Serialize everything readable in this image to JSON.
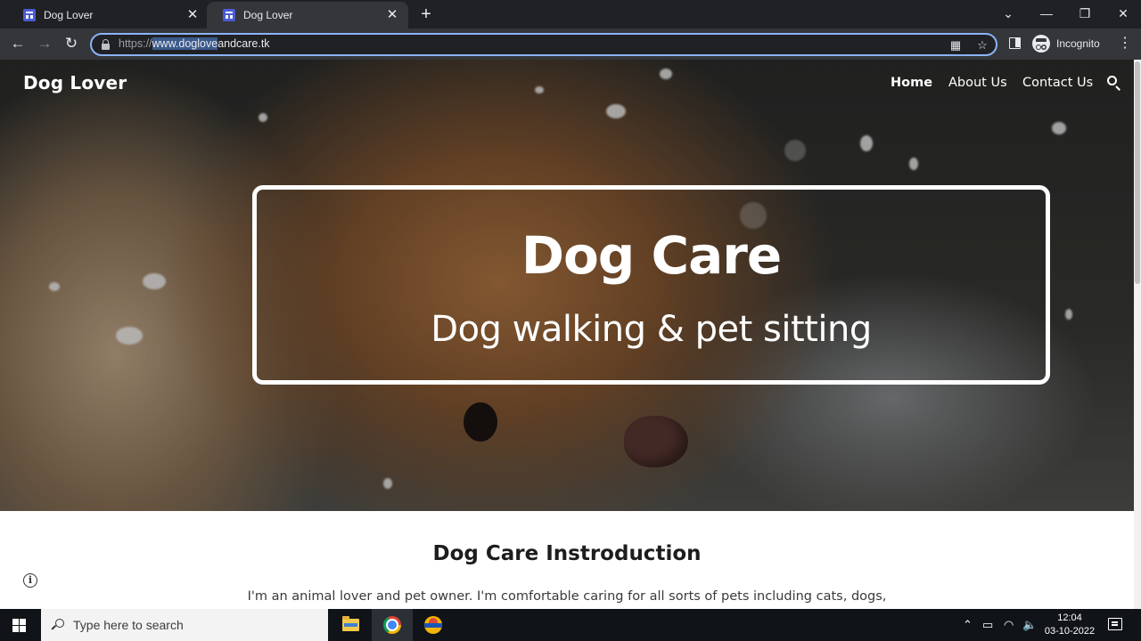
{
  "browser": {
    "tabs": [
      {
        "title": "Dog Lover",
        "active": false
      },
      {
        "title": "Dog Lover",
        "active": true
      }
    ],
    "new_tab": "+",
    "window_controls": {
      "tab_search": "⌄",
      "minimize": "—",
      "restore": "❐",
      "close": "✕"
    },
    "nav": {
      "back": "←",
      "forward": "→",
      "reload": "↻"
    },
    "url": {
      "scheme": "https://",
      "highlighted": "www.doglove",
      "rest": "andcare.tk"
    },
    "profile_label": "Incognito",
    "menu": "⋮"
  },
  "site": {
    "logo": "Dog Lover",
    "nav": [
      {
        "label": "Home",
        "active": true
      },
      {
        "label": "About Us",
        "active": false
      },
      {
        "label": "Contact Us",
        "active": false
      }
    ],
    "hero": {
      "title": "Dog Care",
      "subtitle": "Dog walking & pet sitting"
    },
    "intro": {
      "title": "Dog Care Instroduction",
      "text": "I'm an animal lover and pet owner. I'm comfortable caring for all sorts of pets including cats, dogs,"
    },
    "info_glyph": "i"
  },
  "taskbar": {
    "search_placeholder": "Type here to search",
    "tray": {
      "chevron": "⌃",
      "battery": "▭",
      "wifi": "◠",
      "volume": "🔈"
    },
    "time": "12:04",
    "date": "03-10-2022"
  },
  "colors": {
    "tab_active": "#35363a",
    "titlebar": "#202124",
    "omnibox_focus": "#8ab4f8",
    "hero_text": "#ffffff",
    "taskbar": "#101418"
  }
}
